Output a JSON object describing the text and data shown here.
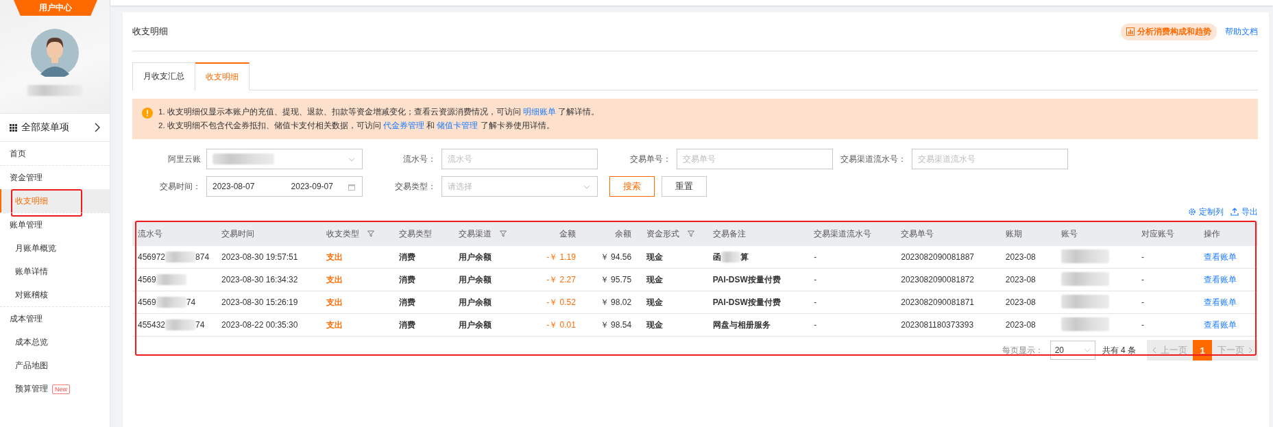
{
  "sidebar": {
    "badge": "用户中心",
    "all_menu": "全部菜单项",
    "items": [
      {
        "label": "首页",
        "kind": "top",
        "selected": false
      },
      {
        "label": "资金管理",
        "kind": "group",
        "selected": false
      },
      {
        "label": "收支明细",
        "kind": "sub",
        "selected": true
      },
      {
        "label": "账单管理",
        "kind": "group",
        "selected": false
      },
      {
        "label": "月账单概览",
        "kind": "sub",
        "selected": false
      },
      {
        "label": "账单详情",
        "kind": "sub",
        "selected": false
      },
      {
        "label": "对账稽核",
        "kind": "sub",
        "selected": false
      },
      {
        "label": "成本管理",
        "kind": "group",
        "selected": false
      },
      {
        "label": "成本总览",
        "kind": "sub",
        "selected": false
      },
      {
        "label": "产品地图",
        "kind": "sub",
        "selected": false
      },
      {
        "label": "预算管理",
        "kind": "sub",
        "selected": false,
        "tag": "New"
      }
    ]
  },
  "page": {
    "title": "收支明细",
    "analysis_button": "分析消费构成和趋势",
    "help_link": "帮助文档"
  },
  "tabs": [
    {
      "label": "月收支汇总",
      "selected": false
    },
    {
      "label": "收支明细",
      "selected": true
    }
  ],
  "notice": {
    "lines": [
      [
        {
          "kind": "text",
          "text": "1. 收支明细仅显示本账户的充值、提现、退款、扣款等资金增减变化；查看云资源消费情况，可访问 "
        },
        {
          "kind": "link",
          "text": "明细账单"
        },
        {
          "kind": "text",
          "text": " 了解详情。"
        }
      ],
      [
        {
          "kind": "text",
          "text": "2. 收支明细不包含代金券抵扣、储值卡支付相关数据，可访问 "
        },
        {
          "kind": "link",
          "text": "代金券管理"
        },
        {
          "kind": "text",
          "text": " 和 "
        },
        {
          "kind": "link",
          "text": "储值卡管理"
        },
        {
          "kind": "text",
          "text": " 了解卡券使用详情。"
        }
      ]
    ]
  },
  "filters": [
    {
      "kind": "account",
      "label": "阿里云账"
    },
    {
      "kind": "input",
      "label": "流水号：",
      "placeholder": "流水号"
    },
    {
      "kind": "input",
      "label": "交易单号：",
      "placeholder": "交易单号"
    },
    {
      "kind": "input",
      "label": "交易渠道流水号：",
      "placeholder": "交易渠道流水号"
    },
    {
      "kind": "daterange",
      "label": "交易时间：",
      "start": "2023-08-07",
      "end": "2023-09-07"
    },
    {
      "kind": "select",
      "label": "交易类型：",
      "placeholder": "请选择"
    }
  ],
  "buttons": {
    "search": "搜索",
    "reset": "重置"
  },
  "table_tools": {
    "columns": "定制列",
    "export": "导出"
  },
  "table": {
    "columns": [
      {
        "label": "流水号",
        "filterable": false
      },
      {
        "label": "交易时间",
        "filterable": false
      },
      {
        "label": "收支类型",
        "filterable": true
      },
      {
        "label": "交易类型",
        "filterable": false
      },
      {
        "label": "交易渠道",
        "filterable": true
      },
      {
        "label": "金额",
        "filterable": false
      },
      {
        "label": "余额",
        "filterable": false
      },
      {
        "label": "资金形式",
        "filterable": true
      },
      {
        "label": "交易备注",
        "filterable": false
      },
      {
        "label": "交易渠道流水号",
        "filterable": false
      },
      {
        "label": "交易单号",
        "filterable": false
      },
      {
        "label": "账期",
        "filterable": false
      },
      {
        "label": "账号",
        "filterable": false
      },
      {
        "label": "对应账号",
        "filterable": false
      },
      {
        "label": "操作",
        "filterable": false
      }
    ],
    "rows": [
      {
        "serial_start": "456972",
        "serial_end": "874",
        "time": "2023-08-30 19:57:51",
        "direction": "支出",
        "type": "消费",
        "channel": "用户余额",
        "amount": "-￥ 1.19",
        "balance": "￥ 94.56",
        "fund_form": "现金",
        "note_start": "函",
        "note_end": "算",
        "channel_serial": "-",
        "order_no": "2023082090081887",
        "period": "2023-08",
        "counter_account": "-",
        "action": "查看账单"
      },
      {
        "serial_start": "4569",
        "time": "2023-08-30 16:34:32",
        "direction": "支出",
        "type": "消费",
        "channel": "用户余额",
        "amount": "-￥ 2.27",
        "balance": "￥ 95.75",
        "fund_form": "现金",
        "note_start": "PAI-DSW按量付费",
        "channel_serial": "-",
        "order_no": "2023082090081872",
        "period": "2023-08",
        "counter_account": "-",
        "action": "查看账单"
      },
      {
        "serial_start": "4569",
        "serial_end": "74",
        "time": "2023-08-30 15:26:19",
        "direction": "支出",
        "type": "消费",
        "channel": "用户余额",
        "amount": "-￥ 0.52",
        "balance": "￥ 98.02",
        "fund_form": "现金",
        "note_start": "PAI-DSW按量付费",
        "channel_serial": "-",
        "order_no": "2023082090081871",
        "period": "2023-08",
        "counter_account": "-",
        "action": "查看账单"
      },
      {
        "serial_start": "455432",
        "serial_end": "74",
        "time": "2023-08-22 00:35:30",
        "direction": "支出",
        "type": "消费",
        "channel": "用户余额",
        "amount": "-￥ 0.01",
        "balance": "￥ 98.54",
        "fund_form": "现金",
        "note_start": "网盘与相册服务",
        "channel_serial": "-",
        "order_no": "2023081180373393",
        "period": "2023-08",
        "counter_account": "-",
        "action": "查看账单"
      }
    ]
  },
  "pagination": {
    "page_size_label": "每页显示：",
    "page_size": "20",
    "total": "共有 4 条",
    "prev": "上一页",
    "prev_disabled": true,
    "pages": [
      {
        "label": "1",
        "selected": true
      }
    ],
    "next": "下一页",
    "next_disabled": true
  }
}
